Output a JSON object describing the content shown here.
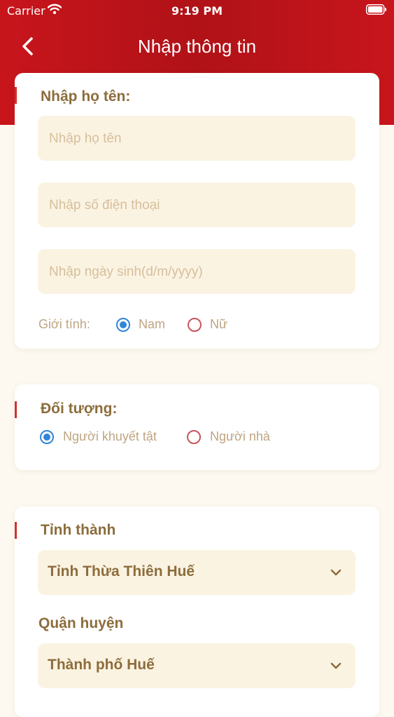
{
  "status_bar": {
    "carrier": "Carrier",
    "time": "9:19 PM"
  },
  "nav": {
    "title": "Nhập thông tin"
  },
  "personal_card": {
    "title": "Nhập họ tên:",
    "name_placeholder": "Nhập họ tên",
    "phone_placeholder": "Nhập số điện thoại",
    "dob_placeholder": "Nhập ngày sinh(d/m/yyyy)",
    "gender_label": "Giới tính:",
    "gender_options": [
      "Nam",
      "Nữ"
    ],
    "gender_selected": "Nam"
  },
  "target_card": {
    "title": "Đối tượng:",
    "options": [
      "Người khuyết tật",
      "Người nhà"
    ],
    "selected": "Người khuyết tật"
  },
  "location_card": {
    "province_title": "Tỉnh thành",
    "province_value": "Tỉnh Thừa Thiên Huế",
    "district_title": "Quận huyện",
    "district_value": "Thành phố Huế"
  },
  "colors": {
    "header_red": "#b01218",
    "accent_red": "#d2302c",
    "text_brown": "#8c6d3c",
    "placeholder": "#d6bf9c",
    "radio_blue": "#2f85d8"
  }
}
